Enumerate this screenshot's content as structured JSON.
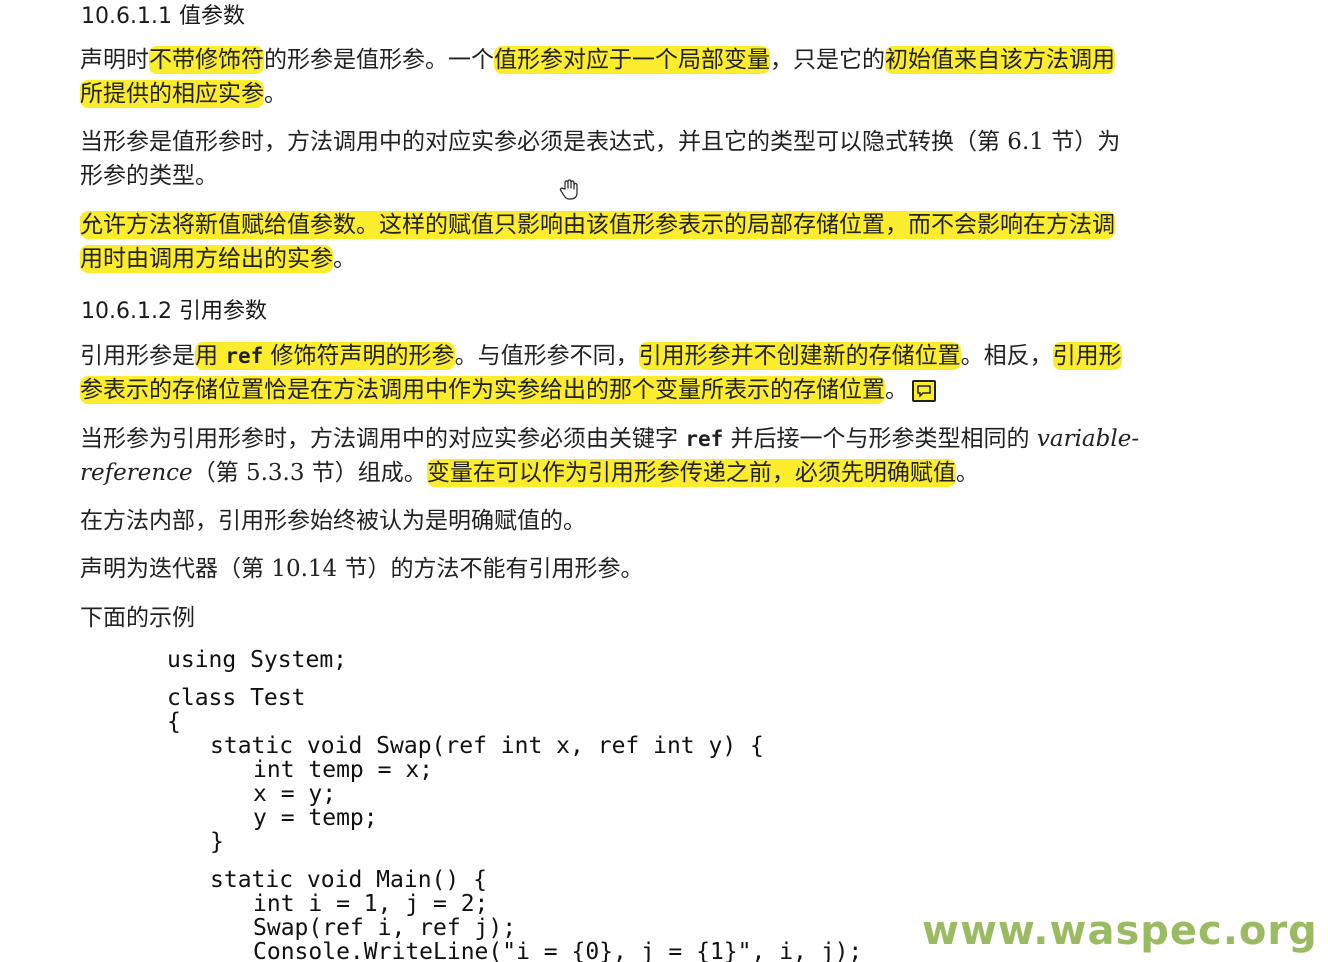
{
  "section_1": {
    "heading": "10.6.1.1 值参数",
    "p1": {
      "t1": "声明时",
      "h1": "不带修饰符",
      "t2": "的形参是值形参。一个",
      "h2": "值形参对应于一个局部变量",
      "t3": "，只是它的",
      "h3": "初始值来自该方法调用",
      "h4": "所提供的相应实参",
      "t4": "。"
    },
    "p2": {
      "line1": "当形参是值形参时，方法调用中的对应实参必须是表达式，并且它的类型可以隐式转换（第 6.1 节）为",
      "line2": "形参的类型。"
    },
    "p3": {
      "h1": "允许方法将新值赋给值参数。这样的赋值只影响由该值形参表示的局部存储位置，而不会影响在方法调",
      "h2": "用时由调用方给出的实参",
      "t1": "。"
    }
  },
  "section_2": {
    "heading": "10.6.1.2 引用参数",
    "p1": {
      "t1": "引用形参是",
      "h1a": "用 ",
      "h1b": "ref",
      "h1c": " 修饰符声明的形参",
      "t2": "。与值形参不同，",
      "h2": "引用形参并不创建新的存储位置",
      "t3": "。相反，",
      "h3": "引用形",
      "h4": "参表示的存储位置恰是在方法调用中作为实参给出的那个变量所表示的存储位置",
      "t4": "。",
      "comment_icon": "speech-bubble-icon"
    },
    "p2": {
      "t1": "当形参为引用形参时，方法调用中的对应实参必须由关键字 ",
      "kw": "ref",
      "t2": " 并后接一个与形参类型相同的 ",
      "it1": "variable-",
      "it2": "reference",
      "t3": "（第 5.3.3 节）组成。",
      "h1": "变量在可以作为引用形参传递之前，必须先明确赋值",
      "t4": "。"
    },
    "p3": "在方法内部，引用形参始终被认为是明确赋值的。",
    "p4": "声明为迭代器（第 10.14 节）的方法不能有引用形参。",
    "p5": "下面的示例"
  },
  "code": {
    "l01": "using System;",
    "l02": "class Test",
    "l03": "{",
    "l04": "static void Swap(ref int x, ref int y) {",
    "l05": "int temp = x;",
    "l06": "x = y;",
    "l07": "y = temp;",
    "l08": "}",
    "l09": "static void Main() {",
    "l10": "int i = 1, j = 2;",
    "l11": "Swap(ref i, ref j);",
    "l12": "Console.WriteLine(\"i = {0}, j = {1}\", i, j);"
  },
  "watermark": "www.waspec.org",
  "colors": {
    "highlight": "#fbec2d",
    "text": "#222222",
    "watermark": "#8ab048"
  },
  "cursor_icon": "hand-cursor-icon"
}
